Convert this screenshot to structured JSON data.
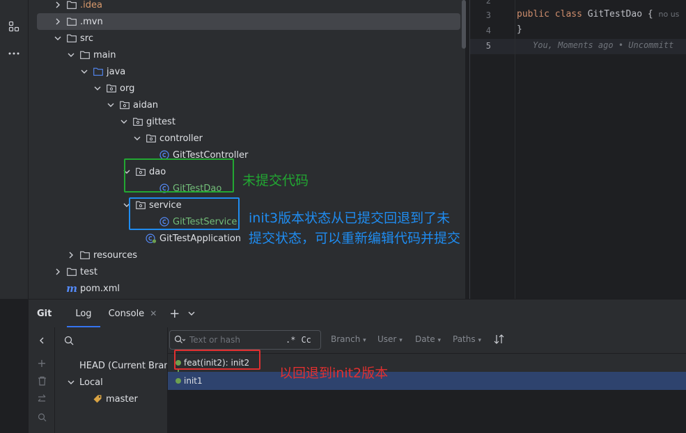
{
  "colors": {
    "annot_green": "#22a832",
    "annot_blue": "#1f8cf0",
    "annot_red": "#e03030"
  },
  "tree": {
    "items": [
      {
        "label": ".idea",
        "icon": "folder-icon",
        "chevron": "right"
      },
      {
        "label": ".mvn",
        "icon": "folder-icon",
        "chevron": "right"
      },
      {
        "label": "src",
        "icon": "folder-icon",
        "chevron": "down"
      },
      {
        "label": "main",
        "icon": "folder-icon",
        "chevron": "down"
      },
      {
        "label": "java",
        "icon": "source-folder-icon",
        "chevron": "down"
      },
      {
        "label": "org",
        "icon": "package-icon",
        "chevron": "down"
      },
      {
        "label": "aidan",
        "icon": "package-icon",
        "chevron": "down"
      },
      {
        "label": "gittest",
        "icon": "package-icon",
        "chevron": "down"
      },
      {
        "label": "controller",
        "icon": "package-icon",
        "chevron": "down"
      },
      {
        "label": "GitTestController",
        "icon": "class-icon",
        "chevron": "none"
      },
      {
        "label": "dao",
        "icon": "package-icon",
        "chevron": "down"
      },
      {
        "label": "GitTestDao",
        "icon": "class-icon",
        "chevron": "none"
      },
      {
        "label": "service",
        "icon": "package-icon",
        "chevron": "down"
      },
      {
        "label": "GitTestService",
        "icon": "class-icon",
        "chevron": "none"
      },
      {
        "label": "GitTestApplication",
        "icon": "spring-class-icon",
        "chevron": "none"
      },
      {
        "label": "resources",
        "icon": "folder-icon",
        "chevron": "right"
      },
      {
        "label": "test",
        "icon": "folder-icon",
        "chevron": "right"
      },
      {
        "label": "pom.xml",
        "icon": "maven-icon",
        "chevron": "none"
      }
    ]
  },
  "editor": {
    "lines": [
      {
        "num": "2",
        "code": ""
      },
      {
        "num": "3",
        "kw": "public class",
        "code": " GitTestDao {",
        "hint": "no us"
      },
      {
        "num": "4",
        "code": "}"
      },
      {
        "num": "5",
        "blame": "You, Moments ago • Uncommitt"
      }
    ]
  },
  "git": {
    "title": "Git",
    "tabs": [
      "Log",
      "Console"
    ],
    "branches": {
      "head": "HEAD (Current Branch)",
      "local": "Local",
      "master": "master"
    },
    "search_placeholder": "Text or hash",
    "regex_opt": ".*",
    "case_opt": "Cc",
    "filters": [
      "Branch",
      "User",
      "Date",
      "Paths"
    ],
    "commits": [
      {
        "message": "feat(init2): init2"
      },
      {
        "message": "init1"
      }
    ]
  },
  "annotations": {
    "uncommitted": "未提交代码",
    "rollback_line1": "init3版本状态从已提交回退到了未",
    "rollback_line2": "提交状态，可以重新编辑代码并提交",
    "rollback_to": "以回退到init2版本"
  }
}
